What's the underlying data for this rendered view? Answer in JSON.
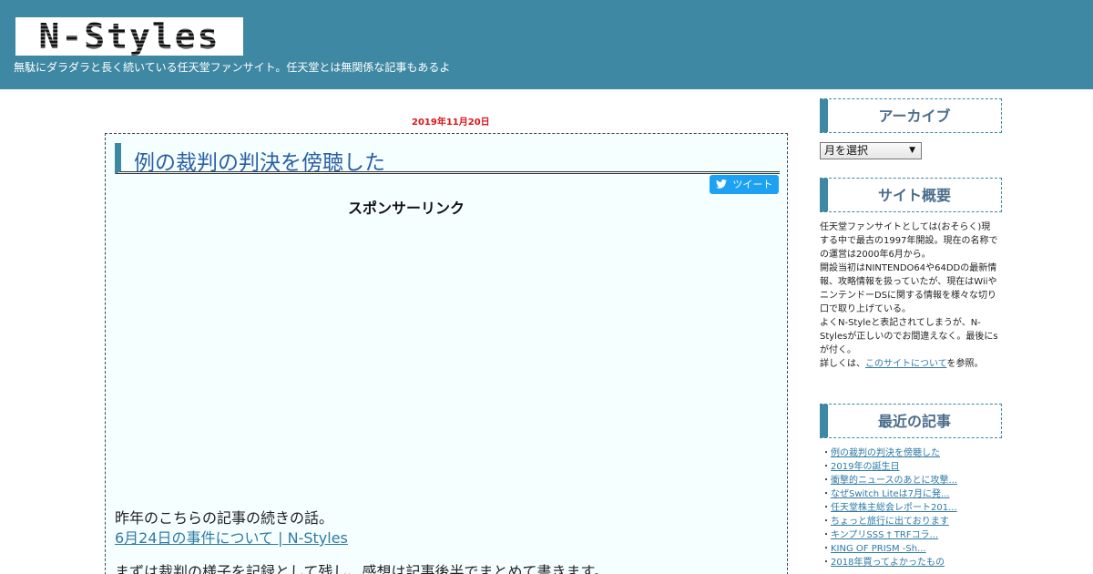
{
  "site": {
    "logo_text": "N-Styles",
    "tagline": "無駄にダラダラと長く続いている任天堂ファンサイト。任天堂とは無関係な記事もあるよ"
  },
  "post": {
    "date": "2019年11月20日",
    "title": "例の裁判の判決を傍聴した",
    "tweet_label": "ツイート",
    "sponsor_label": "スポンサーリンク",
    "paragraph1": "昨年のこちらの記事の続きの話。",
    "link1": "6月24日の事件について | N-Styles",
    "paragraph2": "まずは裁判の様子を記録として残し、感想は記事後半でまとめて書きます。"
  },
  "sidebar": {
    "archive_title": "アーカイブ",
    "archive_select": "月を選択",
    "about_title": "サイト概要",
    "about_lines": [
      "任天堂ファンサイトとしては(おそらく)現",
      "する中で最古の1997年開設。現在の名称で",
      "の運営は2000年6月から。",
      "開設当初はNINTENDO64や64DDの最新情",
      "報、攻略情報を扱っていたが、現在はWiiや",
      "ニンテンドーDSに関する情報を様々な切り",
      "口で取り上げている。",
      "よくN-Styleと表記されてしまうが、N-",
      "Stylesが正しいのでお間違えなく。最後にs",
      "が付く。"
    ],
    "about_more_prefix": "詳しくは、",
    "about_more_link": "このサイトについて",
    "about_more_suffix": "を参照。",
    "recent_title": "最近の記事",
    "recent_items": [
      "例の裁判の判決を傍聴した",
      "2019年の誕生日",
      "衝撃的ニュースのあとに攻撃...",
      "なぜSwitch Liteは7月に発...",
      "任天堂株主総会レポート201...",
      "ちょっと旅行に出ております",
      "キンプリSSS † TRFコラ...",
      "KING OF PRISM -Sh...",
      "2018年買ってよかったもの"
    ]
  },
  "colors": {
    "header_bg": "#3e88a3",
    "date_red": "#d9151a",
    "title_blue": "#2a5fa5",
    "link_blue": "#2e7aa5",
    "twitter": "#1da1f2"
  },
  "icons": {
    "tweet": "twitter-bird-icon",
    "select": "dropdown-arrow-icon"
  }
}
